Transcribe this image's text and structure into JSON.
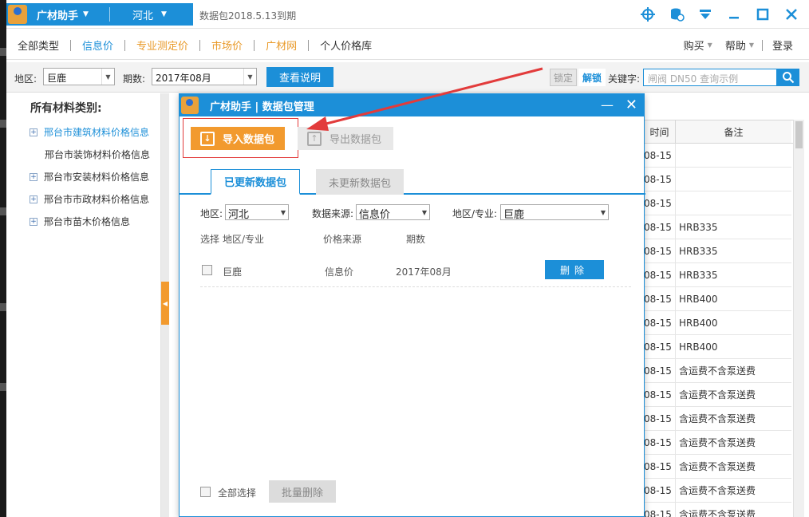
{
  "colors": {
    "accent": "#1c8fd8",
    "orange": "#f29a2e",
    "annotation_red": "#e23b3b"
  },
  "titlebar": {
    "app_name": "广材助手",
    "region": "河北",
    "expire_text": "数据包2018.5.13到期",
    "icons": [
      "crosshair-icon",
      "database-icon",
      "download-icon",
      "minimize-icon",
      "maximize-icon",
      "close-icon"
    ]
  },
  "menu": {
    "items": [
      {
        "label": "全部类型",
        "state": "normal"
      },
      {
        "label": "信息价",
        "state": "active"
      },
      {
        "label": "专业测定价",
        "state": "orange"
      },
      {
        "label": "市场价",
        "state": "orange"
      },
      {
        "label": "广材网",
        "state": "orange"
      },
      {
        "label": "个人价格库",
        "state": "normal"
      }
    ],
    "right": {
      "buy": "购买",
      "help": "帮助",
      "login": "登录"
    }
  },
  "toolbar": {
    "region_label": "地区:",
    "region_value": "巨鹿",
    "period_label": "期数:",
    "period_value": "2017年08月",
    "view_btn": "查看说明",
    "lock_btn": "锁定",
    "unlock_btn": "解锁",
    "keyword_label": "关键字:",
    "keyword_placeholder": "闸阀 DN50 查询示例"
  },
  "categories": {
    "title": "所有材料类别:",
    "items": [
      {
        "label": "邢台市建筑材料价格信息",
        "expandable": true,
        "active": true
      },
      {
        "label": "邢台市装饰材料价格信息",
        "expandable": false,
        "active": false
      },
      {
        "label": "邢台市安装材料价格信息",
        "expandable": true,
        "active": false
      },
      {
        "label": "邢台市市政材料价格信息",
        "expandable": true,
        "active": false
      },
      {
        "label": "邢台市苗木价格信息",
        "expandable": true,
        "active": false
      }
    ]
  },
  "bg_grid": {
    "headers": {
      "time": "时间",
      "note": "备注"
    },
    "rows": [
      {
        "time": "08-15",
        "note": ""
      },
      {
        "time": "08-15",
        "note": ""
      },
      {
        "time": "08-15",
        "note": ""
      },
      {
        "time": "08-15",
        "note": "HRB335"
      },
      {
        "time": "08-15",
        "note": "HRB335"
      },
      {
        "time": "08-15",
        "note": "HRB335"
      },
      {
        "time": "08-15",
        "note": "HRB400"
      },
      {
        "time": "08-15",
        "note": "HRB400"
      },
      {
        "time": "08-15",
        "note": "HRB400"
      },
      {
        "time": "08-15",
        "note": "含运费不含泵送费"
      },
      {
        "time": "08-15",
        "note": "含运费不含泵送费"
      },
      {
        "time": "08-15",
        "note": "含运费不含泵送费"
      },
      {
        "time": "08-15",
        "note": "含运费不含泵送费"
      },
      {
        "time": "08-15",
        "note": "含运费不含泵送费"
      },
      {
        "time": "08-15",
        "note": "含运费不含泵送费"
      },
      {
        "time": "08-15",
        "note": "含运费不含泵送费"
      }
    ]
  },
  "modal": {
    "title": "广材助手 | 数据包管理",
    "import_btn": "导入数据包",
    "export_btn": "导出数据包",
    "tab_updated": "已更新数据包",
    "tab_not_updated": "未更新数据包",
    "filter": {
      "region_label": "地区:",
      "region_value": "河北",
      "source_label": "数据来源:",
      "source_value": "信息价",
      "area_label": "地区/专业:",
      "area_value": "巨鹿"
    },
    "columns": {
      "select": "选择",
      "area": "地区/专业",
      "source": "价格来源",
      "period": "期数"
    },
    "rows": [
      {
        "area": "巨鹿",
        "source": "信息价",
        "period": "2017年08月",
        "delete": "删除"
      }
    ],
    "select_all": "全部选择",
    "batch_delete": "批量删除"
  }
}
